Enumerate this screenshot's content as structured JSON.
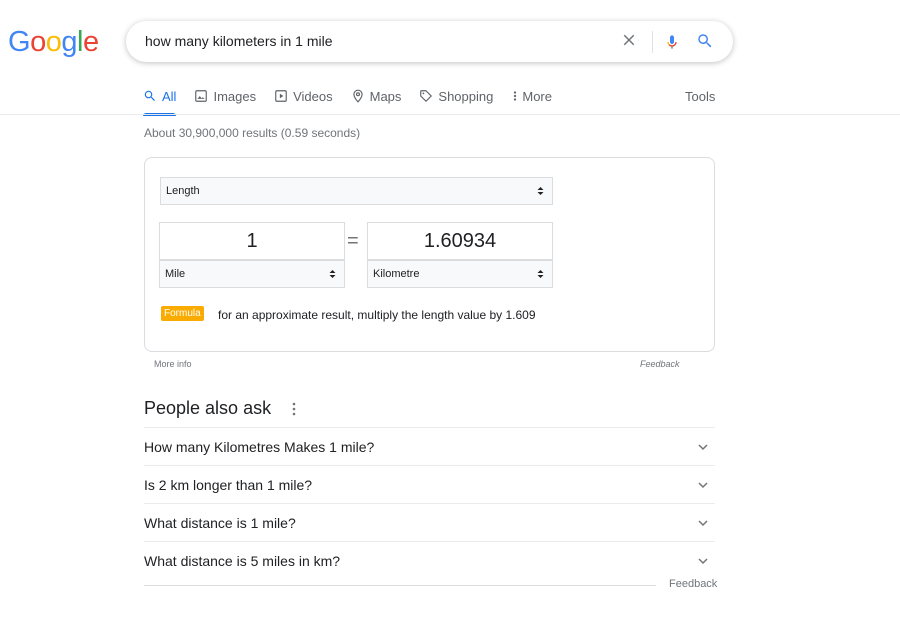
{
  "logo": {
    "text": "Google",
    "colors": [
      "#4285F4",
      "#EA4335",
      "#FBBC05",
      "#4285F4",
      "#34A853",
      "#EA4335"
    ]
  },
  "search": {
    "query": "how many kilometers in 1 mile"
  },
  "tabs": [
    {
      "label": "All",
      "icon": "search-icon",
      "active": true
    },
    {
      "label": "Images",
      "icon": "image-icon"
    },
    {
      "label": "Videos",
      "icon": "play-icon"
    },
    {
      "label": "Maps",
      "icon": "map-pin-icon"
    },
    {
      "label": "Shopping",
      "icon": "tag-icon"
    },
    {
      "label": "More",
      "icon": "more-vert-icon"
    }
  ],
  "tools_label": "Tools",
  "result_stats": "About 30,900,000 results (0.59 seconds)",
  "converter": {
    "unit_type": "Length",
    "from_value": "1",
    "to_value": "1.60934",
    "from_unit": "Mile",
    "to_unit": "Kilometre",
    "formula_badge": "Formula",
    "formula_text": "for an approximate result, multiply the length value by 1.609",
    "more_info": "More info",
    "feedback": "Feedback"
  },
  "people_also_ask": {
    "title": "People also ask",
    "questions": [
      "How many Kilometres Makes 1 mile?",
      "Is 2 km longer than 1 mile?",
      "What distance is 1 mile?",
      "What distance is 5 miles in km?"
    ],
    "feedback": "Feedback"
  },
  "colors": {
    "accent": "#1a73e8",
    "formula_badge": "#f9ab00"
  }
}
